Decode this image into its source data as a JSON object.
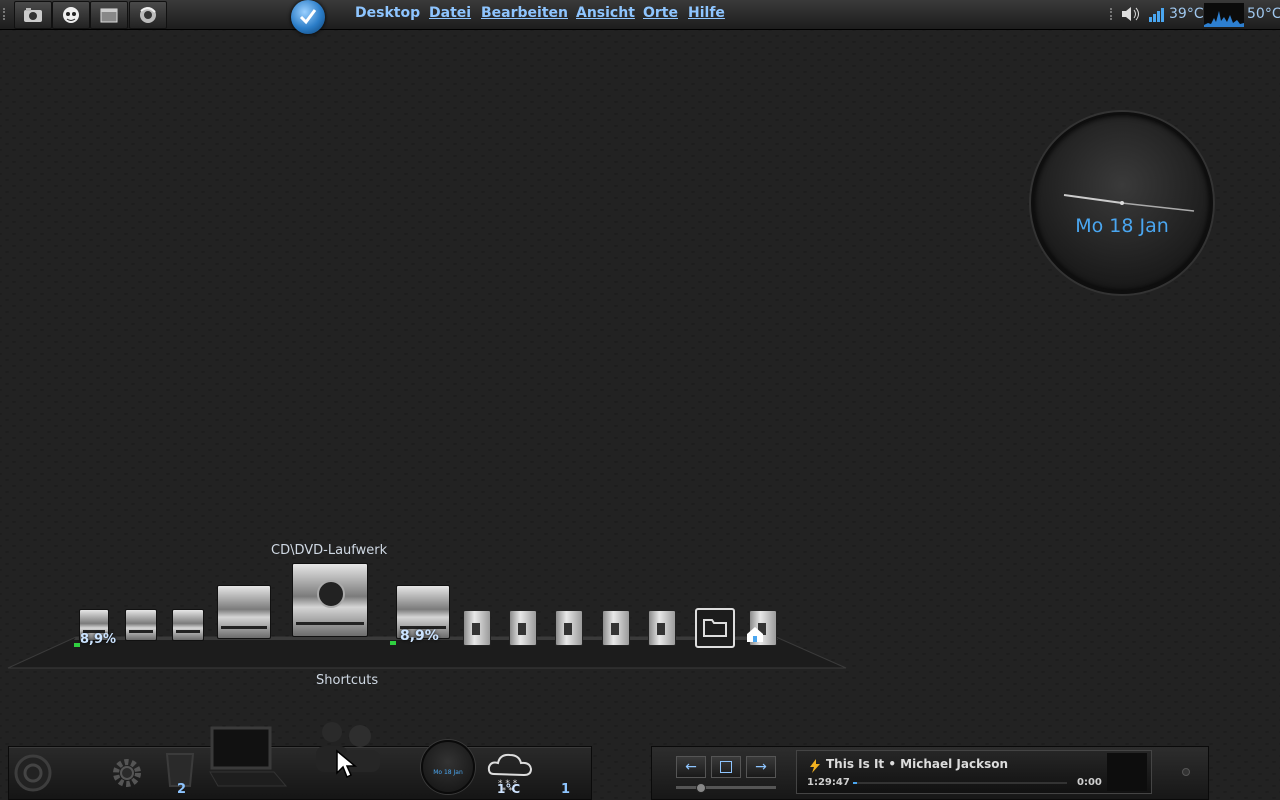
{
  "top_panel": {
    "launchers": [
      {
        "name": "camera-launcher-icon"
      },
      {
        "name": "face-launcher-icon"
      },
      {
        "name": "window-launcher-icon"
      },
      {
        "name": "firefox-launcher-icon"
      }
    ],
    "menu": [
      "Desktop",
      "Datei",
      "Bearbeiten",
      "Ansicht",
      "Orte",
      "Hilfe"
    ],
    "tray": {
      "cpu_temp": "39°C",
      "gpu_temp": "50°C"
    }
  },
  "clock_widget": {
    "date": "Mo 18 Jan"
  },
  "dock": {
    "cd_label": "CD\\DVD-Laufwerk",
    "shortcuts_label": "Shortcuts",
    "drive_usage_left": "8,9%",
    "drive_usage_right": "8,9%"
  },
  "bottom_left_panel": {
    "trash_count": "2",
    "mini_clock_date": "Mo 18 Jan",
    "weather_temp": "1°C",
    "workspace": "1"
  },
  "bottom_right_panel": {
    "player": {
      "track": "This Is It • Michael Jackson",
      "elapsed": "1:29:47",
      "total": "0:00"
    }
  },
  "colors": {
    "accent": "#4aa6f0",
    "menu_text": "#8ec5ff",
    "background": "#191919"
  }
}
